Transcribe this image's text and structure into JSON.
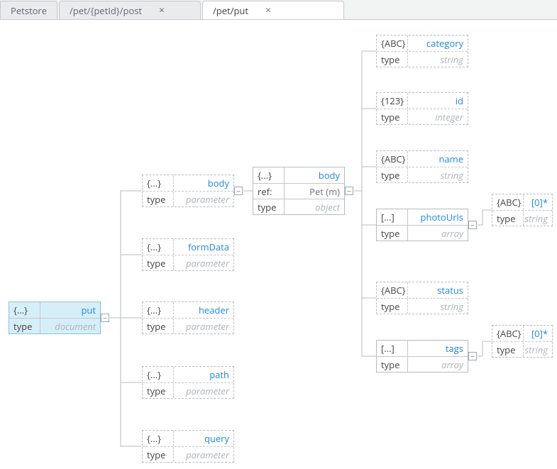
{
  "tabs": [
    {
      "label": "Petstore",
      "closable": false,
      "active": false
    },
    {
      "label": "/pet/{petId}/post",
      "closable": true,
      "active": false
    },
    {
      "label": "/pet/put",
      "closable": true,
      "active": true
    }
  ],
  "typeLabel": "type",
  "refLabel": "ref:",
  "glyph": {
    "obj": "{...}",
    "num": "{123}",
    "str": "{ABC}",
    "arr": "[...]"
  },
  "toggle": "−",
  "root": {
    "title": "put",
    "type": "document"
  },
  "params": [
    {
      "title": "body",
      "type": "parameter"
    },
    {
      "title": "formData",
      "type": "parameter"
    },
    {
      "title": "header",
      "type": "parameter"
    },
    {
      "title": "path",
      "type": "parameter"
    },
    {
      "title": "query",
      "type": "parameter"
    }
  ],
  "bodyObj": {
    "title": "body",
    "ref": "Pet (m)",
    "type": "object"
  },
  "fields": [
    {
      "glyph": "str",
      "title": "category",
      "type": "string"
    },
    {
      "glyph": "num",
      "title": "id",
      "type": "integer"
    },
    {
      "glyph": "str",
      "title": "name",
      "type": "string"
    },
    {
      "glyph": "arr",
      "title": "photoUrls",
      "type": "array"
    },
    {
      "glyph": "str",
      "title": "status",
      "type": "string"
    },
    {
      "glyph": "arr",
      "title": "tags",
      "type": "array"
    }
  ],
  "arrayItem": {
    "title": "[0]*",
    "type": "string"
  }
}
